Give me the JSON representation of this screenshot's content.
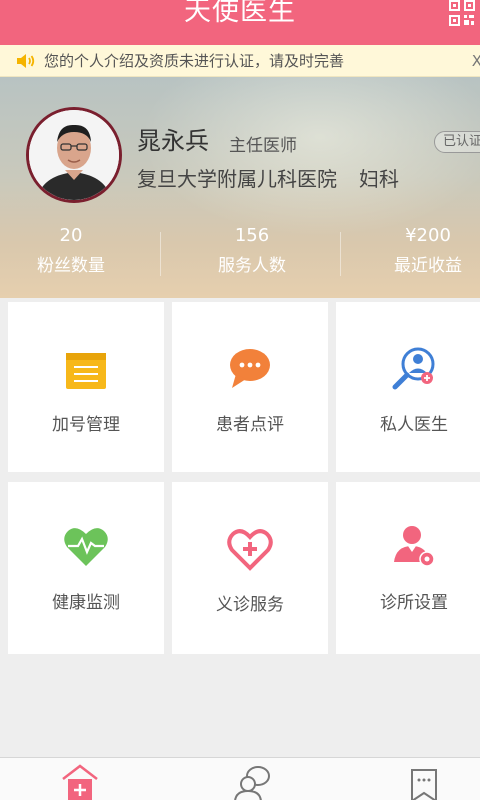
{
  "header": {
    "title": "天使医生",
    "qr_icon": "qr-code-icon"
  },
  "notice": {
    "icon": "speaker-icon",
    "text": "您的个人介绍及资质未进行认证，请及时完善",
    "close": "X"
  },
  "profile": {
    "name": "晁永兵",
    "title": "主任医师",
    "verified_badge": "已认证",
    "hospital": "复旦大学附属儿科医院",
    "department": "妇科"
  },
  "stats": [
    {
      "value": "20",
      "label": "粉丝数量"
    },
    {
      "value": "156",
      "label": "服务人数"
    },
    {
      "value": "¥200",
      "label": "最近收益"
    }
  ],
  "grid": [
    {
      "label": "加号管理",
      "icon": "clipboard-icon",
      "color": "#f7b81a"
    },
    {
      "label": "患者点评",
      "icon": "chat-bubble-icon",
      "color": "#f2813a"
    },
    {
      "label": "私人医生",
      "icon": "doctor-search-icon",
      "color": "#3f7fd6"
    },
    {
      "label": "健康监测",
      "icon": "heart-pulse-icon",
      "color": "#6cc35a"
    },
    {
      "label": "义诊服务",
      "icon": "heart-cross-icon",
      "color": "#f2657e"
    },
    {
      "label": "诊所设置",
      "icon": "doctor-settings-icon",
      "color": "#f2657e"
    }
  ],
  "tabbar": {
    "icons": [
      "home-icon",
      "consult-icon",
      "bookmark-icon"
    ]
  },
  "colors": {
    "accent": "#f2657e",
    "notice_bg": "#fff8d9"
  }
}
